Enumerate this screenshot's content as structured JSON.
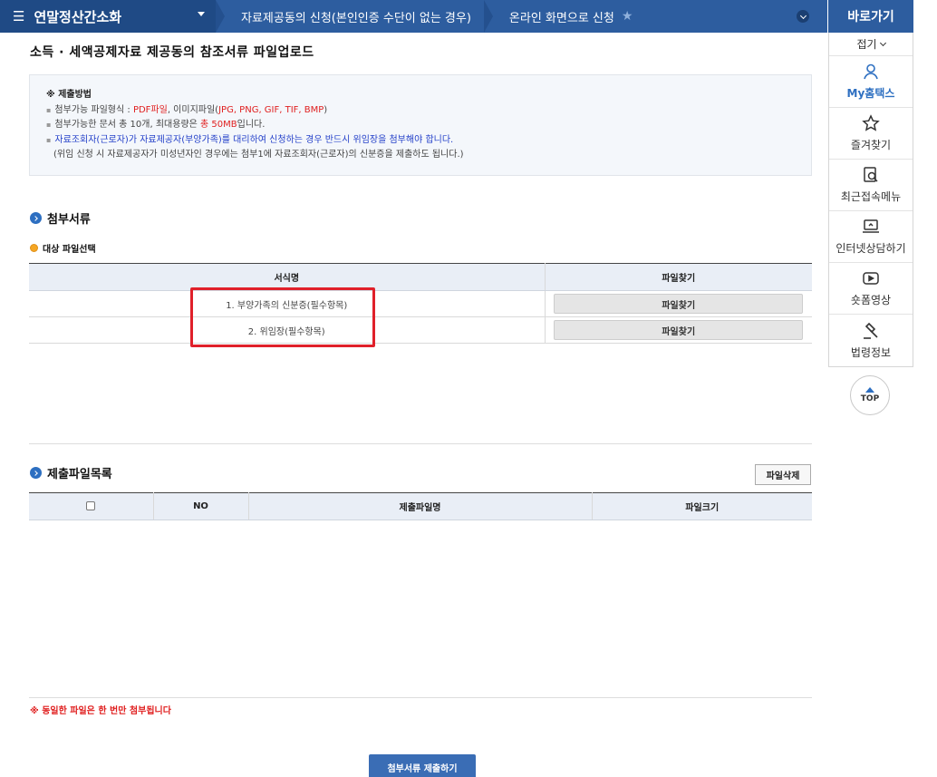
{
  "topbar": {
    "menu_icon": "☰",
    "menu_title": "연말정산간소화",
    "crumbs": [
      "자료제공동의 신청(본인인증 수단이 없는 경우)",
      "온라인 화면으로 신청"
    ],
    "star": "★"
  },
  "quick": {
    "header": "바로가기",
    "fold_label": "접기",
    "items": [
      {
        "label": "My홈택스",
        "icon": "person-icon"
      },
      {
        "label": "즐겨찾기",
        "icon": "star-icon"
      },
      {
        "label": "최근접속메뉴",
        "icon": "recent-search-icon"
      },
      {
        "label": "인터넷상담하기",
        "icon": "monitor-icon"
      },
      {
        "label": "숏폼영상",
        "icon": "play-icon"
      },
      {
        "label": "법령정보",
        "icon": "gavel-icon"
      }
    ],
    "top_label": "TOP"
  },
  "page": {
    "title": "소득 · 세액공제자료 제공동의 참조서류 파일업로드"
  },
  "notice": {
    "title": "※ 제출방법",
    "line1_prefix": "첨부가능 파일형식 : ",
    "line1_red": "PDF파일",
    "line1_mid": ", 이미지파일(",
    "line1_red2": "JPG, PNG, GIF, TIF, BMP",
    "line1_suffix": ")",
    "line2_prefix": "첨부가능한 문서 총 10개, 최대용량은 ",
    "line2_red": "총 50MB",
    "line2_suffix": "입니다.",
    "line3": "자료조회자(근로자)가 자료제공자(부양가족)를 대리하여 신청하는 경우 반드시 위임장을 첨부해야 합니다.",
    "line4": "(위임 신청 시 자료제공자가 미성년자인 경우에는 첨부1에 자료조회자(근로자)의 신분증을 제출하도 됩니다.)"
  },
  "attach": {
    "section_title": "첨부서류",
    "sub_title": "대상 파일선택",
    "headers": [
      "서식명",
      "파일찾기"
    ],
    "rows": [
      {
        "name": "1. 부양가족의 신분증(필수항목)",
        "button": "파일찾기"
      },
      {
        "name": "2. 위임장(필수항목)",
        "button": "파일찾기"
      }
    ]
  },
  "submitted": {
    "section_title": "제출파일목록",
    "delete_button": "파일삭제",
    "headers": [
      "NO",
      "제출파일명",
      "파일크기"
    ]
  },
  "warning": "※ 동일한 파일은 한 번만 첨부됩니다",
  "submit_button": "첨부서류 제출하기",
  "colors": {
    "nav": "#2d5d9f",
    "accent": "#2d6fc1",
    "highlight": "#e0202a",
    "warning": "#e02020"
  }
}
